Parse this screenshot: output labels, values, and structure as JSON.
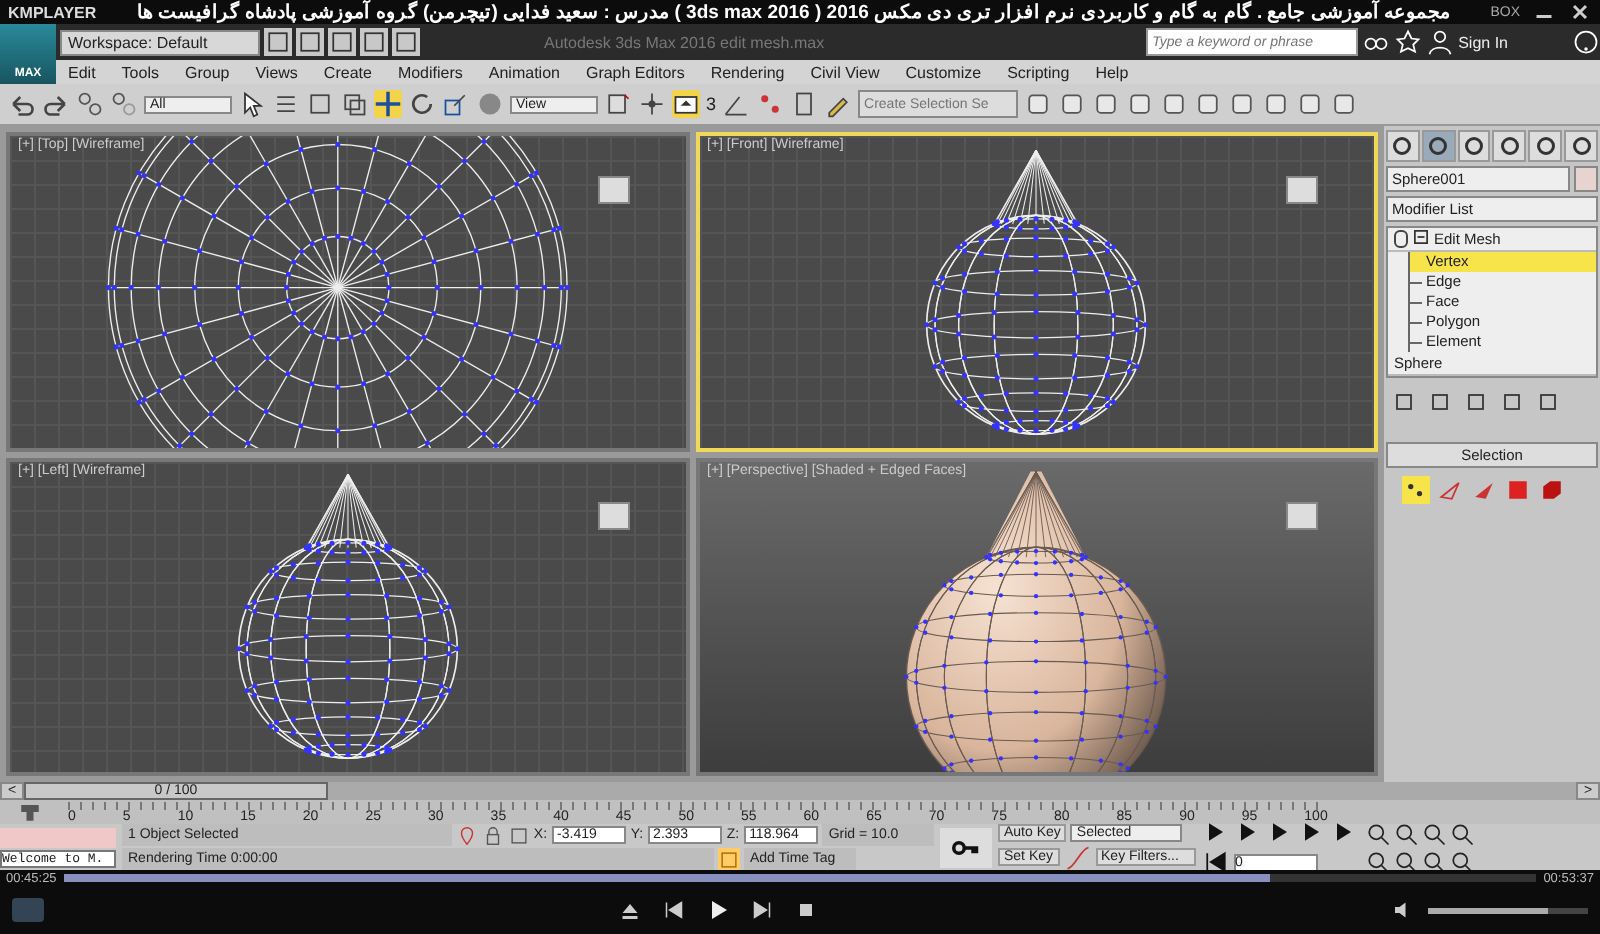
{
  "player": {
    "brand": "KMPLAYER",
    "title": "مجموعه آموزشی جامع . گام به گام و کاربردی نرم افزار تری دی مکس 2016  ( 3ds max 2016 )  مدرس : سعید فدایی (تیچرمن) گروه آموزشی پادشاه گرافیست ها",
    "box": "BOX",
    "elapsed": "00:45:25",
    "total": "00:53:37",
    "level": 0.82,
    "volume": {
      "level": 0.75
    }
  },
  "app": {
    "logo": "MAX",
    "workspace": "Workspace: Default",
    "title": "Autodesk 3ds Max 2016     edit mesh.max",
    "search_placeholder": "Type a keyword or phrase",
    "sign_in": "Sign In"
  },
  "menu": [
    "Edit",
    "Tools",
    "Group",
    "Views",
    "Create",
    "Modifiers",
    "Animation",
    "Graph Editors",
    "Rendering",
    "Civil View",
    "Customize",
    "Scripting",
    "Help"
  ],
  "toolbar": {
    "filter": "All",
    "coord": "View",
    "snap": "3",
    "selection_set_placeholder": "Create Selection Se"
  },
  "viewports": [
    {
      "label": "[+] [Top] [Wireframe]",
      "kind": "top",
      "active": false
    },
    {
      "label": "[+] [Front] [Wireframe]",
      "kind": "front",
      "active": true
    },
    {
      "label": "[+] [Left] [Wireframe]",
      "kind": "front",
      "active": false
    },
    {
      "label": "[+] [Perspective] [Shaded + Edged Faces]",
      "kind": "shaded",
      "active": false
    }
  ],
  "command_panel": {
    "tabs": [
      {
        "selected": false
      },
      {
        "selected": true
      },
      {
        "selected": false
      },
      {
        "selected": false
      },
      {
        "selected": false
      },
      {
        "selected": false
      }
    ],
    "object_name": "Sphere001",
    "modifier_list": "Modifier List",
    "stack": [
      {
        "label": "Edit Mesh",
        "expanded": true,
        "selected": false,
        "children": [
          {
            "label": "Vertex",
            "selected": true
          },
          {
            "label": "Edge",
            "selected": false
          },
          {
            "label": "Face",
            "selected": false
          },
          {
            "label": "Polygon",
            "selected": false
          },
          {
            "label": "Element",
            "selected": false
          }
        ]
      },
      {
        "label": "Sphere",
        "selected": false
      }
    ],
    "rollout": "Selection",
    "subobjects": [
      {
        "selected": true
      },
      {
        "selected": false
      },
      {
        "selected": false
      },
      {
        "selected": false
      },
      {
        "selected": false
      }
    ]
  },
  "timeline": {
    "previous": "<",
    "slider": "0 / 100",
    "next": ">",
    "ticks": [
      "0",
      "5",
      "10",
      "15",
      "20",
      "25",
      "30",
      "35",
      "40",
      "45",
      "50",
      "55",
      "60",
      "65",
      "70",
      "75",
      "80",
      "85",
      "90",
      "95",
      "100"
    ]
  },
  "status": {
    "listener": "Welcome to M.",
    "selection": "1 Object Selected",
    "render_time": "Rendering Time  0:00:00",
    "coordinates": [
      {
        "label": "X:",
        "value": "-3.419"
      },
      {
        "label": "Y:",
        "value": "2.393"
      },
      {
        "label": "Z:",
        "value": "118.964"
      }
    ],
    "grid": "Grid = 10.0",
    "add_time_tag": "Add Time Tag",
    "auto_key": "Auto Key",
    "set_key": "Set Key",
    "key_mode": "Selected",
    "key_filters": "Key Filters...",
    "frame": "0"
  }
}
